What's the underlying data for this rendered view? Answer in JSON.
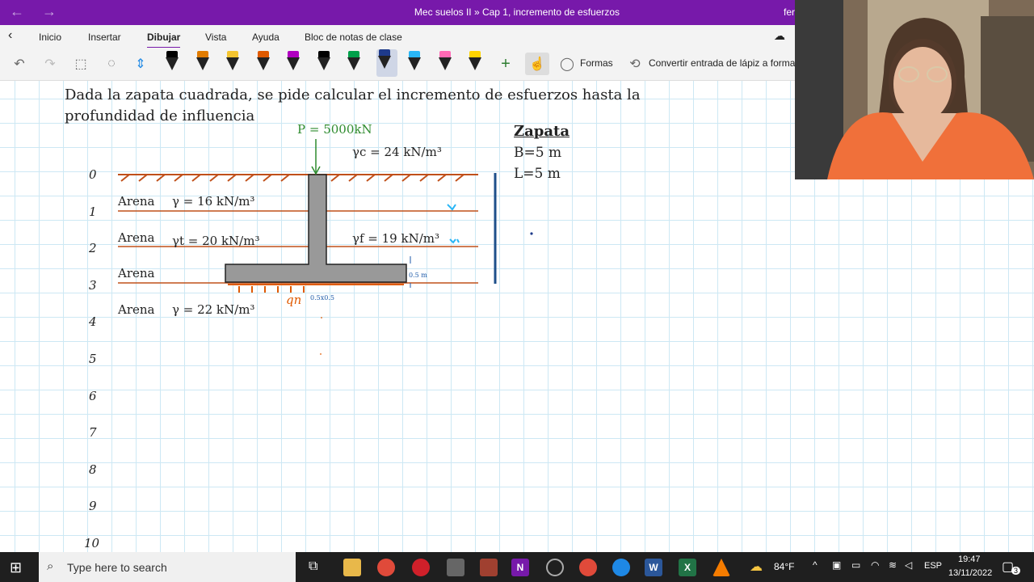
{
  "titlebar": {
    "title": "Mec suelos II » Cap 1, incremento de esfuerzos",
    "user": "fer",
    "back_icon": "arrow-left-icon",
    "forward_icon": "arrow-right-icon"
  },
  "tabs": [
    "Inicio",
    "Insertar",
    "Dibujar",
    "Vista",
    "Ayuda",
    "Bloc de notas de clase"
  ],
  "active_tab": "Dibujar",
  "toolbar": {
    "shapes_label": "Formas",
    "convert_label": "Convertir entrada de lápiz a forma",
    "pen_colors": [
      "#000000",
      "#e07b00",
      "#f4c430",
      "#e05a00",
      "#b000c0",
      "#000000",
      "#00a04a",
      "#1e3a8a",
      "#29b6f6",
      "#ff69b4",
      "#ffd400"
    ]
  },
  "note": {
    "problem_line1": "Dada la zapata cuadrada, se pide calcular el incremento de esfuerzos hasta la",
    "problem_line2": "profundidad de influencia",
    "load": "P = 5000kN",
    "gamma_c": "γc = 24 kN/m³",
    "zapata_title": "Zapata",
    "B": "B=5 m",
    "L": "L=5 m",
    "layers": [
      {
        "name": "Arena",
        "gamma": "γ = 16 kN/m³"
      },
      {
        "name": "Arena",
        "gamma": "γt = 20 kN/m³"
      },
      {
        "name": "Arena",
        "gamma": ""
      },
      {
        "name": "Arena",
        "gamma": "γ = 22 kN/m³"
      }
    ],
    "gamma_f": "γf = 19 kN/m³",
    "thickness_note": "0.5 m",
    "column_note": "0.5x0.5",
    "qn": "qn",
    "depths": [
      "0",
      "1",
      "2",
      "3",
      "4",
      "5",
      "6",
      "7",
      "8",
      "9",
      "10"
    ]
  },
  "taskbar": {
    "search_placeholder": "Type here to search",
    "weather": "84°F",
    "language": "ESP",
    "time": "19:47",
    "date": "13/11/2022",
    "notifications": "3"
  }
}
